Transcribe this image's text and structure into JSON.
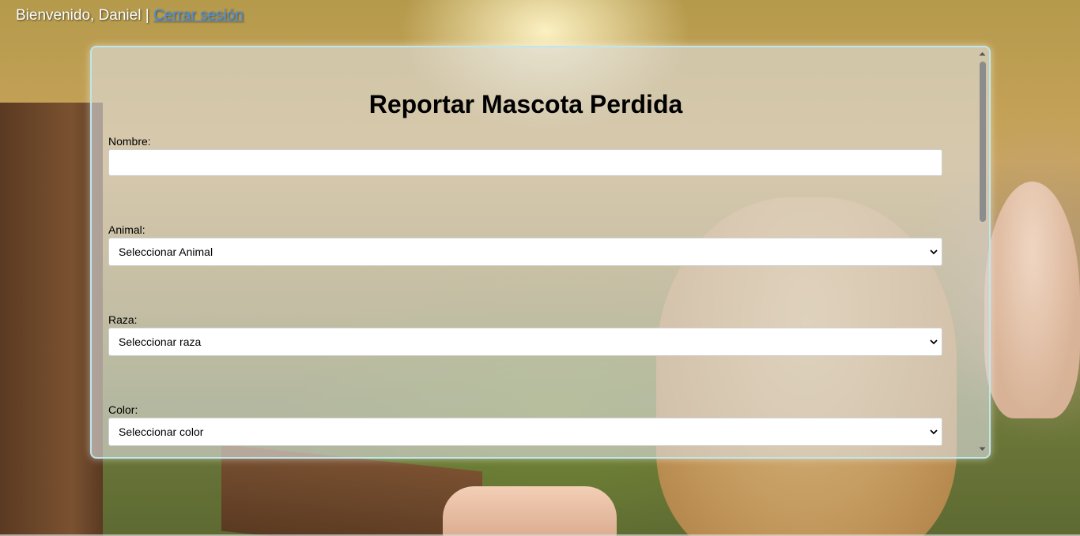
{
  "topbar": {
    "greeting": "Bienvenido, Daniel",
    "separator": " | ",
    "logout_label": "Cerrar sesión"
  },
  "form": {
    "title": "Reportar Mascota Perdida",
    "name_label": "Nombre:",
    "name_value": "",
    "animal_label": "Animal:",
    "animal_selected": "Seleccionar Animal",
    "breed_label": "Raza:",
    "breed_selected": "Seleccionar raza",
    "color_label": "Color:",
    "color_selected": "Seleccionar color"
  },
  "icons": {
    "select": "chevron-down-icon",
    "scroll_up": "triangle-up-icon",
    "scroll_down": "triangle-down-icon"
  },
  "colors": {
    "link": "#4a90e2",
    "panel_border": "#bfe6ea",
    "scroll_thumb": "#8c8c8c"
  }
}
